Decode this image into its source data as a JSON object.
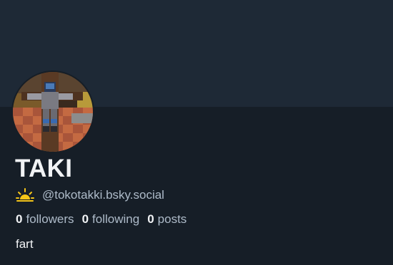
{
  "profile": {
    "display_name": "TAKI",
    "handle": "@tokotakki.bsky.social",
    "handle_icon": "sunrise-icon",
    "bio": "fart",
    "stats": {
      "followers_count": "0",
      "followers_label": "followers",
      "following_count": "0",
      "following_label": "following",
      "posts_count": "0",
      "posts_label": "posts"
    }
  },
  "colors": {
    "background": "#161e27",
    "banner": "#1e2936",
    "text_primary": "#f1f3f5",
    "text_secondary": "#aebbc9",
    "icon_sun": "#f5c518"
  }
}
